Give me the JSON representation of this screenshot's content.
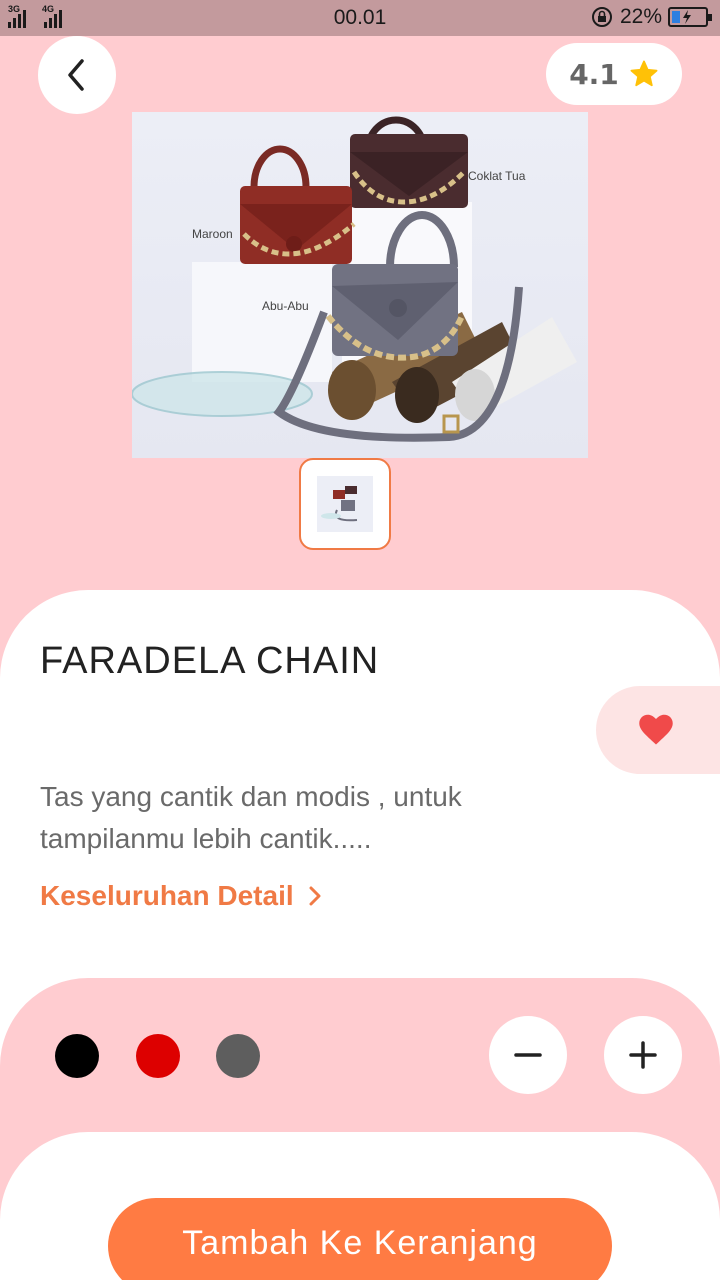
{
  "status_bar": {
    "signal_1_label": "3G",
    "signal_2_label": "4G",
    "time": "00.01",
    "battery_percent": "22%",
    "battery_level": 0.22
  },
  "header": {
    "back_icon": "chevron-left-icon",
    "rating": "4.1",
    "rating_icon": "star-icon",
    "star_color": "#ffc107"
  },
  "product": {
    "image_labels": {
      "dark_brown": "Coklat Tua",
      "maroon": "Maroon",
      "grey": "Abu-Abu"
    },
    "title": "FARADELA CHAIN",
    "description": "Tas yang cantik dan modis , untuk tampilanmu lebih cantik.....",
    "detail_link": "Keseluruhan Detail",
    "favorite_icon": "heart-icon",
    "favorite_color": "#f04a4a"
  },
  "options": {
    "colors": [
      "#000000",
      "#dd0000",
      "#5e5e5e"
    ],
    "decrease_icon": "minus-icon",
    "increase_icon": "plus-icon"
  },
  "cta": {
    "add_to_cart": "Tambah Ke Keranjang"
  },
  "theme": {
    "accent": "#ff7b43",
    "background": "#ffccd0"
  }
}
